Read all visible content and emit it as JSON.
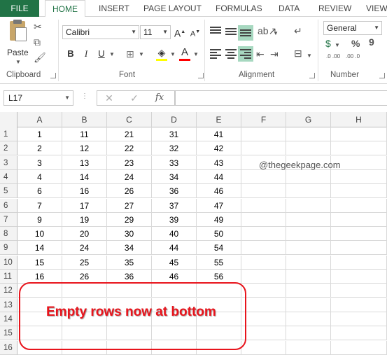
{
  "tabs": {
    "file": "FILE",
    "home": "HOME",
    "insert": "INSERT",
    "page_layout": "PAGE LAYOUT",
    "formulas": "FORMULAS",
    "data": "DATA",
    "review": "REVIEW",
    "view": "VIEW"
  },
  "ribbon": {
    "clipboard": {
      "paste_label": "Paste",
      "group_label": "Clipboard"
    },
    "font": {
      "font_name": "Calibri",
      "font_size": "11",
      "group_label": "Font",
      "bold": "B",
      "italic": "I",
      "underline": "U",
      "grow": "A",
      "shrink": "A",
      "font_color_letter": "A"
    },
    "alignment": {
      "group_label": "Alignment"
    },
    "number": {
      "format": "General",
      "group_label": "Number",
      "percent": "%",
      "comma": "9",
      "inc_decimal": ".0 .00",
      "dec_decimal": ".00 .0"
    }
  },
  "formula_bar": {
    "name_box": "L17",
    "fx": "fx",
    "cancel": "✕",
    "enter": "✓",
    "content": ""
  },
  "columns": [
    "A",
    "B",
    "C",
    "D",
    "E",
    "F",
    "G",
    "H"
  ],
  "rows": [
    {
      "num": "1",
      "cells": [
        "1",
        "11",
        "21",
        "31",
        "41"
      ]
    },
    {
      "num": "2",
      "cells": [
        "2",
        "12",
        "22",
        "32",
        "42"
      ]
    },
    {
      "num": "3",
      "cells": [
        "3",
        "13",
        "23",
        "33",
        "43"
      ]
    },
    {
      "num": "4",
      "cells": [
        "4",
        "14",
        "24",
        "34",
        "44"
      ]
    },
    {
      "num": "5",
      "cells": [
        "6",
        "16",
        "26",
        "36",
        "46"
      ]
    },
    {
      "num": "6",
      "cells": [
        "7",
        "17",
        "27",
        "37",
        "47"
      ]
    },
    {
      "num": "7",
      "cells": [
        "9",
        "19",
        "29",
        "39",
        "49"
      ]
    },
    {
      "num": "8",
      "cells": [
        "10",
        "20",
        "30",
        "40",
        "50"
      ]
    },
    {
      "num": "9",
      "cells": [
        "14",
        "24",
        "34",
        "44",
        "54"
      ]
    },
    {
      "num": "10",
      "cells": [
        "15",
        "25",
        "35",
        "45",
        "55"
      ]
    },
    {
      "num": "11",
      "cells": [
        "16",
        "26",
        "36",
        "46",
        "56"
      ]
    },
    {
      "num": "12",
      "cells": [
        "",
        "",
        "",
        "",
        ""
      ]
    },
    {
      "num": "13",
      "cells": [
        "",
        "",
        "",
        "",
        ""
      ]
    },
    {
      "num": "14",
      "cells": [
        "",
        "",
        "",
        "",
        ""
      ]
    },
    {
      "num": "15",
      "cells": [
        "",
        "",
        "",
        "",
        ""
      ]
    },
    {
      "num": "16",
      "cells": [
        "",
        "",
        "",
        "",
        ""
      ]
    }
  ],
  "watermark": "@thegeekpage.com",
  "annotation": "Empty rows now at bottom",
  "colors": {
    "accent": "#217346",
    "annotation": "#e8141c",
    "align_highlight": "#a7d8c0"
  }
}
